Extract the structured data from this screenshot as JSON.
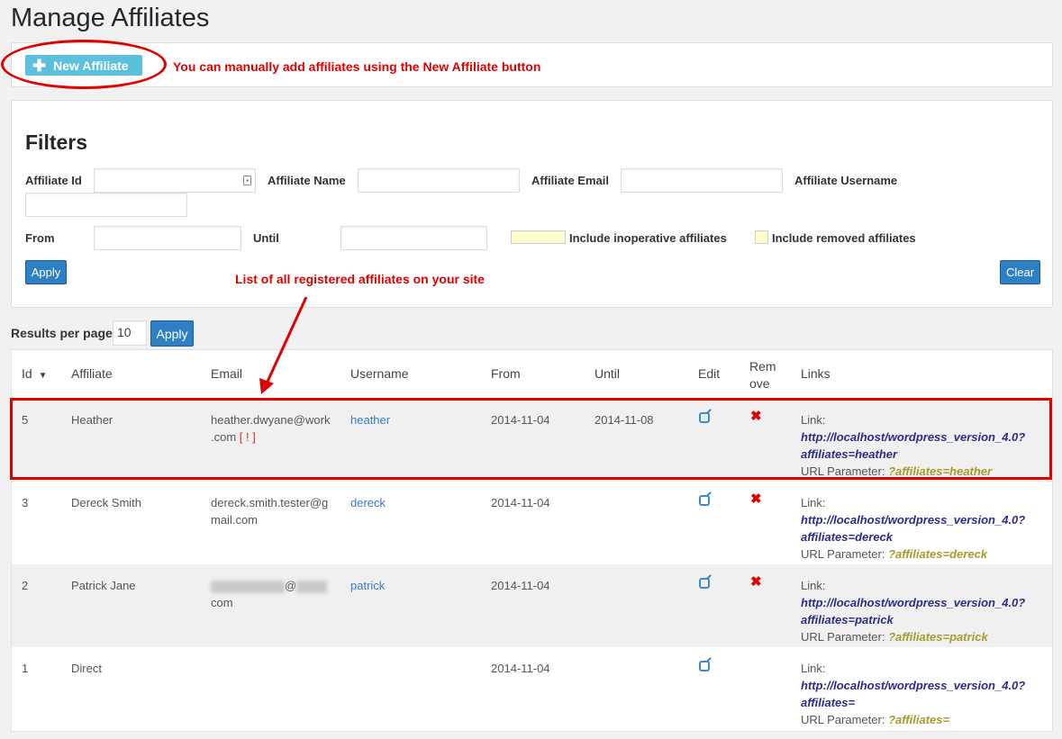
{
  "page": {
    "title": "Manage Affiliates"
  },
  "new_affiliate": {
    "button_label": "New Affiliate",
    "annotation": "You can manually add affiliates using the New Affiliate button"
  },
  "filters": {
    "title": "Filters",
    "affiliate_id_label": "Affiliate Id",
    "affiliate_id_value": "",
    "affiliate_name_label": "Affiliate Name",
    "affiliate_name_value": "",
    "affiliate_email_label": "Affiliate Email",
    "affiliate_email_value": "",
    "affiliate_username_label": "Affiliate Username",
    "affiliate_username_value": "",
    "from_label": "From",
    "from_value": "",
    "until_label": "Until",
    "until_value": "",
    "include_inoperative_label": "Include inoperative affiliates",
    "include_removed_label": "Include removed affiliates",
    "apply_label": "Apply",
    "clear_label": "Clear"
  },
  "list_annotation": "List of all registered affiliates on your site",
  "results_per_page": {
    "label": "Results per page",
    "value": "10",
    "apply_label": "Apply"
  },
  "table": {
    "headers": {
      "id": "Id",
      "sort_icon": "▼",
      "affiliate": "Affiliate",
      "email": "Email",
      "username": "Username",
      "from": "From",
      "until": "Until",
      "edit": "Edit",
      "remove_line1": "Rem",
      "remove_line2": "ove",
      "links": "Links"
    },
    "rows": [
      {
        "id": "5",
        "affiliate": "Heather",
        "email_line1": "heather.dwyane@work",
        "email_line2": ".com",
        "email_flag": "[ ! ]",
        "username": "heather",
        "from": "2014-11-04",
        "until": "2014-11-08",
        "link_label": "Link:",
        "url_line1": "http://localhost/wordpress_version_4.0?",
        "url_line2": "affiliates=heather",
        "param_label": "URL Parameter:",
        "param": "?affiliates=heather"
      },
      {
        "id": "3",
        "affiliate": "Dereck Smith",
        "email_line1": "dereck.smith.tester@g",
        "email_line2": "mail.com",
        "username": "dereck",
        "from": "2014-11-04",
        "until": "",
        "link_label": "Link:",
        "url_line1": "http://localhost/wordpress_version_4.0?",
        "url_line2": "affiliates=dereck",
        "param_label": "URL Parameter:",
        "param": "?affiliates=dereck"
      },
      {
        "id": "2",
        "affiliate": "Patrick Jane",
        "email_line1": "@",
        "email_line2": "com",
        "username": "patrick",
        "from": "2014-11-04",
        "until": "",
        "link_label": "Link:",
        "url_line1": "http://localhost/wordpress_version_4.0?",
        "url_line2": "affiliates=patrick",
        "param_label": "URL Parameter:",
        "param": "?affiliates=patrick"
      },
      {
        "id": "1",
        "affiliate": "Direct",
        "username": "",
        "from": "2014-11-04",
        "until": "",
        "link_label": "Link:",
        "url_line1": "http://localhost/wordpress_version_4.0?",
        "url_line2": "affiliates=",
        "param_label": "URL Parameter:",
        "param": "?affiliates="
      }
    ]
  },
  "colors": {
    "annotation_red": "#e00000",
    "primary_blue": "#2e80c4",
    "info_button": "#5bc0de"
  }
}
